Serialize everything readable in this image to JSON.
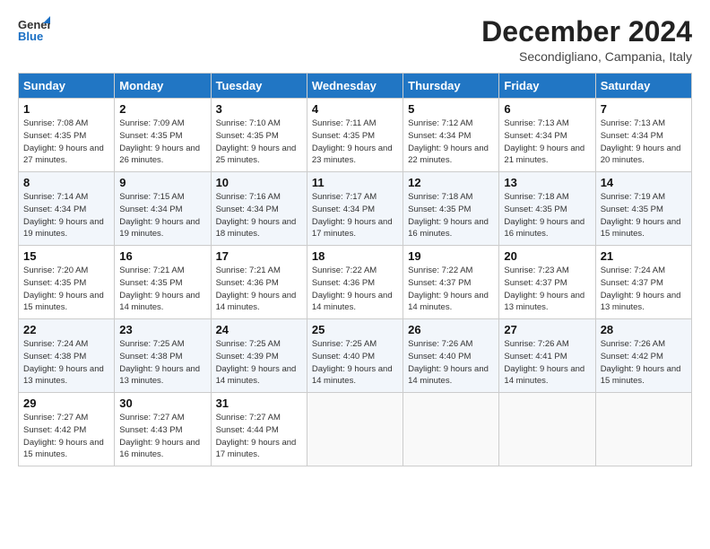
{
  "logo": {
    "line1": "General",
    "line2": "Blue"
  },
  "title": "December 2024",
  "location": "Secondigliano, Campania, Italy",
  "headers": [
    "Sunday",
    "Monday",
    "Tuesday",
    "Wednesday",
    "Thursday",
    "Friday",
    "Saturday"
  ],
  "weeks": [
    [
      {
        "num": "1",
        "rise": "7:08 AM",
        "set": "4:35 PM",
        "daylight": "9 hours and 27 minutes."
      },
      {
        "num": "2",
        "rise": "7:09 AM",
        "set": "4:35 PM",
        "daylight": "9 hours and 26 minutes."
      },
      {
        "num": "3",
        "rise": "7:10 AM",
        "set": "4:35 PM",
        "daylight": "9 hours and 25 minutes."
      },
      {
        "num": "4",
        "rise": "7:11 AM",
        "set": "4:35 PM",
        "daylight": "9 hours and 23 minutes."
      },
      {
        "num": "5",
        "rise": "7:12 AM",
        "set": "4:34 PM",
        "daylight": "9 hours and 22 minutes."
      },
      {
        "num": "6",
        "rise": "7:13 AM",
        "set": "4:34 PM",
        "daylight": "9 hours and 21 minutes."
      },
      {
        "num": "7",
        "rise": "7:13 AM",
        "set": "4:34 PM",
        "daylight": "9 hours and 20 minutes."
      }
    ],
    [
      {
        "num": "8",
        "rise": "7:14 AM",
        "set": "4:34 PM",
        "daylight": "9 hours and 19 minutes."
      },
      {
        "num": "9",
        "rise": "7:15 AM",
        "set": "4:34 PM",
        "daylight": "9 hours and 19 minutes."
      },
      {
        "num": "10",
        "rise": "7:16 AM",
        "set": "4:34 PM",
        "daylight": "9 hours and 18 minutes."
      },
      {
        "num": "11",
        "rise": "7:17 AM",
        "set": "4:34 PM",
        "daylight": "9 hours and 17 minutes."
      },
      {
        "num": "12",
        "rise": "7:18 AM",
        "set": "4:35 PM",
        "daylight": "9 hours and 16 minutes."
      },
      {
        "num": "13",
        "rise": "7:18 AM",
        "set": "4:35 PM",
        "daylight": "9 hours and 16 minutes."
      },
      {
        "num": "14",
        "rise": "7:19 AM",
        "set": "4:35 PM",
        "daylight": "9 hours and 15 minutes."
      }
    ],
    [
      {
        "num": "15",
        "rise": "7:20 AM",
        "set": "4:35 PM",
        "daylight": "9 hours and 15 minutes."
      },
      {
        "num": "16",
        "rise": "7:21 AM",
        "set": "4:35 PM",
        "daylight": "9 hours and 14 minutes."
      },
      {
        "num": "17",
        "rise": "7:21 AM",
        "set": "4:36 PM",
        "daylight": "9 hours and 14 minutes."
      },
      {
        "num": "18",
        "rise": "7:22 AM",
        "set": "4:36 PM",
        "daylight": "9 hours and 14 minutes."
      },
      {
        "num": "19",
        "rise": "7:22 AM",
        "set": "4:37 PM",
        "daylight": "9 hours and 14 minutes."
      },
      {
        "num": "20",
        "rise": "7:23 AM",
        "set": "4:37 PM",
        "daylight": "9 hours and 13 minutes."
      },
      {
        "num": "21",
        "rise": "7:24 AM",
        "set": "4:37 PM",
        "daylight": "9 hours and 13 minutes."
      }
    ],
    [
      {
        "num": "22",
        "rise": "7:24 AM",
        "set": "4:38 PM",
        "daylight": "9 hours and 13 minutes."
      },
      {
        "num": "23",
        "rise": "7:25 AM",
        "set": "4:38 PM",
        "daylight": "9 hours and 13 minutes."
      },
      {
        "num": "24",
        "rise": "7:25 AM",
        "set": "4:39 PM",
        "daylight": "9 hours and 14 minutes."
      },
      {
        "num": "25",
        "rise": "7:25 AM",
        "set": "4:40 PM",
        "daylight": "9 hours and 14 minutes."
      },
      {
        "num": "26",
        "rise": "7:26 AM",
        "set": "4:40 PM",
        "daylight": "9 hours and 14 minutes."
      },
      {
        "num": "27",
        "rise": "7:26 AM",
        "set": "4:41 PM",
        "daylight": "9 hours and 14 minutes."
      },
      {
        "num": "28",
        "rise": "7:26 AM",
        "set": "4:42 PM",
        "daylight": "9 hours and 15 minutes."
      }
    ],
    [
      {
        "num": "29",
        "rise": "7:27 AM",
        "set": "4:42 PM",
        "daylight": "9 hours and 15 minutes."
      },
      {
        "num": "30",
        "rise": "7:27 AM",
        "set": "4:43 PM",
        "daylight": "9 hours and 16 minutes."
      },
      {
        "num": "31",
        "rise": "7:27 AM",
        "set": "4:44 PM",
        "daylight": "9 hours and 17 minutes."
      },
      null,
      null,
      null,
      null
    ]
  ]
}
